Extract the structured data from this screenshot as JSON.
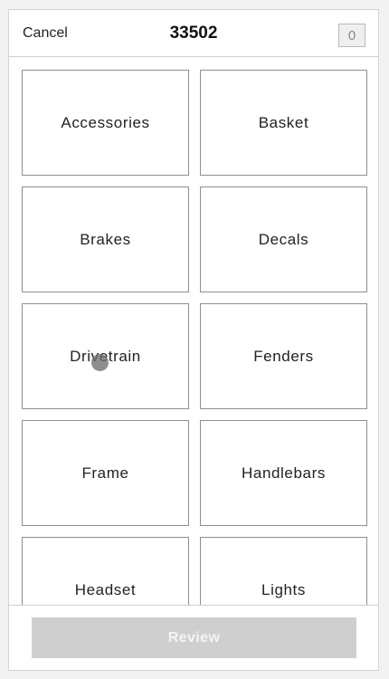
{
  "header": {
    "cancel_label": "Cancel",
    "title": "33502",
    "count": "0"
  },
  "categories": [
    "Accessories",
    "Basket",
    "Brakes",
    "Decals",
    "Drivetrain",
    "Fenders",
    "Frame",
    "Handlebars",
    "Headset",
    "Lights"
  ],
  "footer": {
    "review_label": "Review"
  }
}
